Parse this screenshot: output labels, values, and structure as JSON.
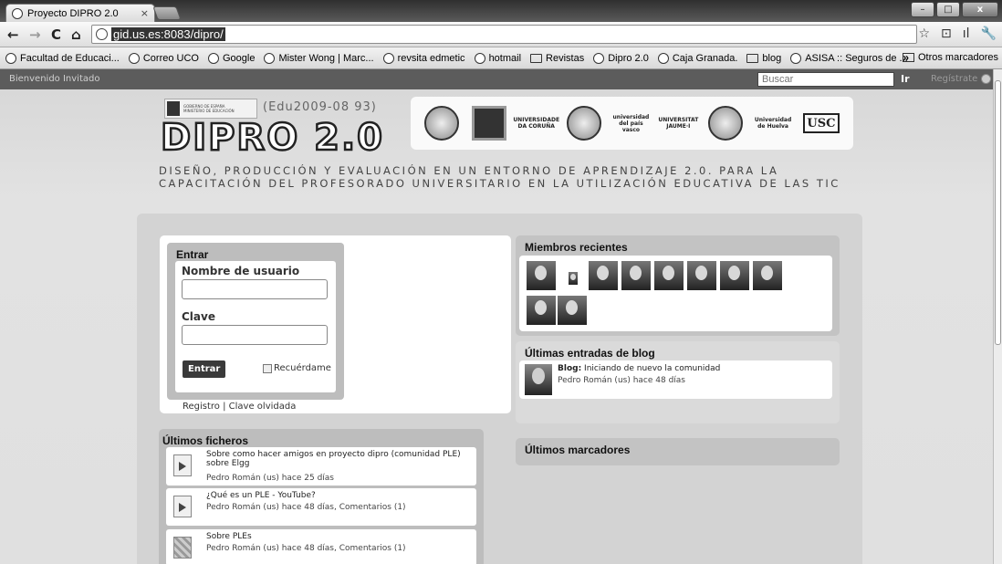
{
  "browser": {
    "tab_title": "Proyecto DIPRO 2.0",
    "tab_close": "×",
    "url": "gid.us.es:8083/dipro/",
    "nav": {
      "back": "←",
      "forward": "→",
      "reload": "C",
      "home": "⌂"
    },
    "right_icons": [
      "☆",
      "⊡",
      "ıl",
      "🔧"
    ],
    "window_buttons": {
      "minimize": "–",
      "maximize": "□",
      "close": "x"
    }
  },
  "bookmarks": {
    "items": [
      {
        "label": "Facultad de Educaci...",
        "icon": "globe-icon"
      },
      {
        "label": "Correo UCO",
        "icon": "globe-icon"
      },
      {
        "label": "Google",
        "icon": "globe-icon"
      },
      {
        "label": "Mister Wong | Marc...",
        "icon": "globe-icon"
      },
      {
        "label": "revsita edmetic",
        "icon": "globe-icon"
      },
      {
        "label": "hotmail",
        "icon": "globe-icon"
      },
      {
        "label": "Revistas",
        "icon": "folder-icon"
      },
      {
        "label": "Dipro 2.0",
        "icon": "globe-icon"
      },
      {
        "label": "Caja Granada.",
        "icon": "globe-icon"
      },
      {
        "label": "blog",
        "icon": "folder-icon"
      },
      {
        "label": "ASISA :: Seguros de ...",
        "icon": "globe-icon"
      }
    ],
    "overflow": "»",
    "other": "Otros marcadores"
  },
  "site": {
    "welcome": "Bienvenido Invitado",
    "search_placeholder": "Buscar",
    "search_go": "Ir",
    "register": "Regístrate"
  },
  "header": {
    "ministry_line1": "GOBIERNO DE ESPAÑA",
    "ministry_line2": "MINISTERIO DE EDUCACIÓN",
    "project_code": "(Edu2009-08 93)",
    "logo": "DIPRO 2.0",
    "tagline": "DISEÑO, PRODUCCIÓN Y EVALUACIÓN  EN UN ENTORNO DE APRENDIZAJE 2.0. PARA LA CAPACITACIÓN DEL PROFESORADO UNIVERSITARIO EN LA UTILIZACIÓN EDUCATIVA DE LAS TIC",
    "universities": [
      {
        "label": "",
        "style": "seal"
      },
      {
        "label": "",
        "style": "sq"
      },
      {
        "label": "UNIVERSIDADE DA CORUÑA",
        "style": "txt"
      },
      {
        "label": "",
        "style": "seal"
      },
      {
        "label": "universidad del país vasco",
        "style": "txt"
      },
      {
        "label": "UNIVERSITAT JAUME·I",
        "style": "txt"
      },
      {
        "label": "",
        "style": "seal"
      },
      {
        "label": "Universidad de Huelva",
        "style": "txt"
      },
      {
        "label": "USC",
        "style": "usc"
      }
    ]
  },
  "login": {
    "title": "Entrar",
    "username_label": "Nombre de usuario",
    "password_label": "Clave",
    "submit": "Entrar",
    "remember": "Recuérdame",
    "register_link": "Registro",
    "separator": "|",
    "forgot_link": "Clave olvidada"
  },
  "files": {
    "title": "Últimos ficheros",
    "items": [
      {
        "title": "Sobre como hacer amigos en proyecto dipro (comunidad PLE) sobre Elgg",
        "meta": "Pedro Román (us) hace 25 días"
      },
      {
        "title": "¿Qué es un PLE - YouTube?",
        "meta": "Pedro Román (us) hace 48 días, Comentarios (1)"
      },
      {
        "title": "Sobre PLEs",
        "meta": "Pedro Román (us) hace 48 días, Comentarios (1)"
      }
    ]
  },
  "members": {
    "title": "Miembros recientes",
    "count": 10
  },
  "blog": {
    "title": "Últimas entradas de blog",
    "entry_prefix": "Blog:",
    "entry_title": "Iniciando de nuevo la comunidad",
    "entry_meta": "Pedro Román (us) hace 48 días"
  },
  "bookmarks_section": {
    "title": "Últimos marcadores"
  }
}
